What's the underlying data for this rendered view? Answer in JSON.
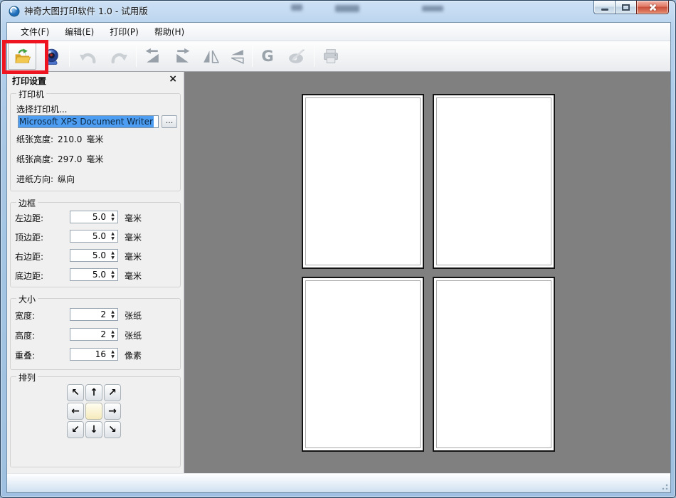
{
  "window": {
    "title": "神奇大图打印软件 1.0 - 试用版",
    "controls": [
      "minimize",
      "maximize",
      "close"
    ]
  },
  "menu": {
    "items": [
      {
        "label": "文件(F)"
      },
      {
        "label": "编辑(E)"
      },
      {
        "label": "打印(P)"
      },
      {
        "label": "帮助(H)"
      }
    ]
  },
  "toolbar": {
    "g_label": "G",
    "buttons": [
      "open-file-icon",
      "camera-zoom-icon",
      "undo-icon",
      "redo-icon",
      "rotate-left-icon",
      "rotate-right-icon",
      "flip-horizontal-icon",
      "flip-vertical-icon",
      "g-icon",
      "palette-icon",
      "print-icon"
    ],
    "annotation": "red-highlight-on-open-button"
  },
  "panel": {
    "title": "打印设置",
    "close_glyph": "×",
    "spin_up_glyph": "▲",
    "spin_down_glyph": "▼",
    "printer_group": {
      "label": "打印机",
      "select_label": "选择打印机...",
      "printer_name": "Microsoft XPS Document Writer",
      "browse_label": "...",
      "info_rows": [
        {
          "label": "纸张宽度:",
          "value": "210.0",
          "unit": "毫米"
        },
        {
          "label": "纸张高度:",
          "value": "297.0",
          "unit": "毫米"
        },
        {
          "label": "进纸方向:",
          "value": "纵向",
          "unit": ""
        }
      ]
    },
    "border_group": {
      "label": "边框",
      "rows": [
        {
          "label": "左边距:",
          "value": "5.0",
          "unit": "毫米"
        },
        {
          "label": "顶边距:",
          "value": "5.0",
          "unit": "毫米"
        },
        {
          "label": "右边距:",
          "value": "5.0",
          "unit": "毫米"
        },
        {
          "label": "底边距:",
          "value": "5.0",
          "unit": "毫米"
        }
      ]
    },
    "size_group": {
      "label": "大小",
      "rows": [
        {
          "label": "宽度:",
          "value": "2",
          "unit": "张纸"
        },
        {
          "label": "高度:",
          "value": "2",
          "unit": "张纸"
        },
        {
          "label": "重叠:",
          "value": "16",
          "unit": "像素"
        }
      ]
    },
    "arrange_group": {
      "label": "排列",
      "arrows": [
        "↖",
        "↑",
        "↗",
        "←",
        "",
        "→",
        "↙",
        "↓",
        "↘"
      ]
    }
  },
  "canvas": {
    "page_count": 4,
    "layout": "2x2",
    "background": "#808080"
  },
  "colors": {
    "selection_bg": "#4d9ef2",
    "annotation_red": "#ee1520",
    "canvas_gray": "#808080",
    "arrange_center": "#f6eabc",
    "titlebar_blue": "#a7c7e5"
  }
}
